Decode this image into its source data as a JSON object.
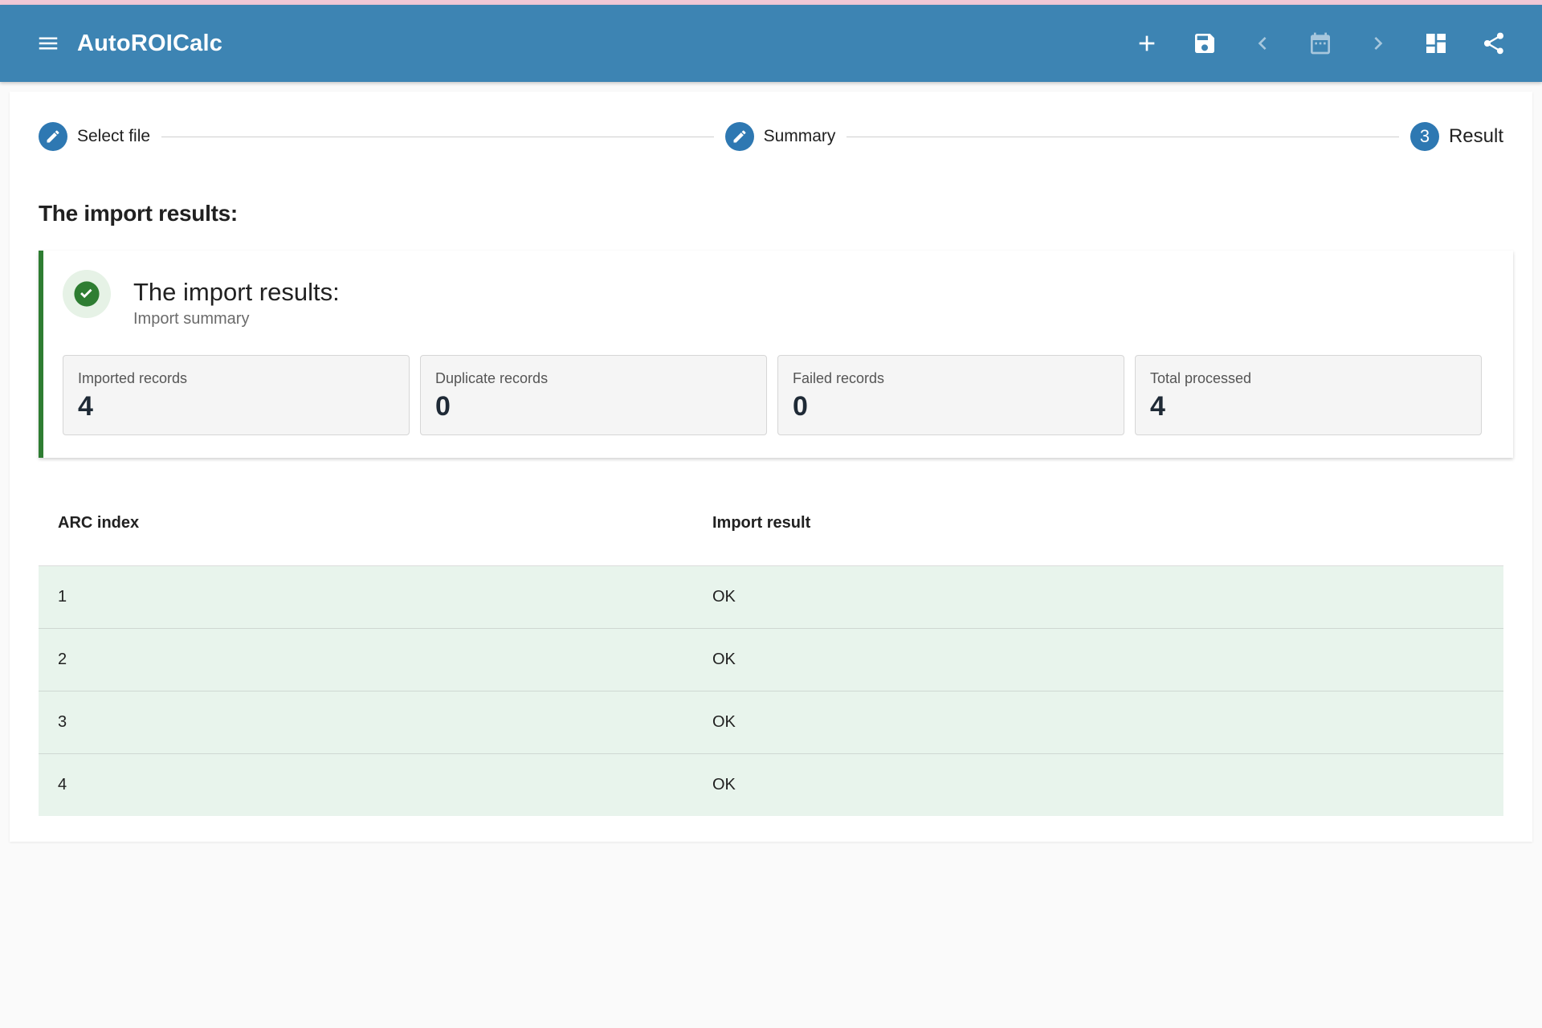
{
  "app": {
    "title": "AutoROICalc"
  },
  "toolbar": {
    "actions": [
      {
        "name": "add-icon"
      },
      {
        "name": "save-icon"
      },
      {
        "name": "chevron-left-icon"
      },
      {
        "name": "calendar-icon"
      },
      {
        "name": "chevron-right-icon"
      },
      {
        "name": "dashboard-icon"
      },
      {
        "name": "share-icon"
      }
    ]
  },
  "stepper": {
    "steps": [
      {
        "label": "Select file",
        "icon": "edit-icon"
      },
      {
        "label": "Summary",
        "icon": "edit-icon"
      },
      {
        "label": "Result",
        "number": "3"
      }
    ]
  },
  "page": {
    "heading": "The import results:"
  },
  "alert": {
    "title": "The import results:",
    "subtitle": "Import summary",
    "stats": [
      {
        "label": "Imported records",
        "value": "4"
      },
      {
        "label": "Duplicate records",
        "value": "0"
      },
      {
        "label": "Failed records",
        "value": "0"
      },
      {
        "label": "Total processed",
        "value": "4"
      }
    ]
  },
  "table": {
    "headers": [
      "ARC index",
      "Import result"
    ],
    "rows": [
      [
        "1",
        "OK"
      ],
      [
        "2",
        "OK"
      ],
      [
        "3",
        "OK"
      ],
      [
        "4",
        "OK"
      ]
    ]
  },
  "colors": {
    "appbar": "#3d84b3",
    "step": "#2e78b2",
    "success": "#2e7d32",
    "row_bg": "#e8f4ec"
  }
}
